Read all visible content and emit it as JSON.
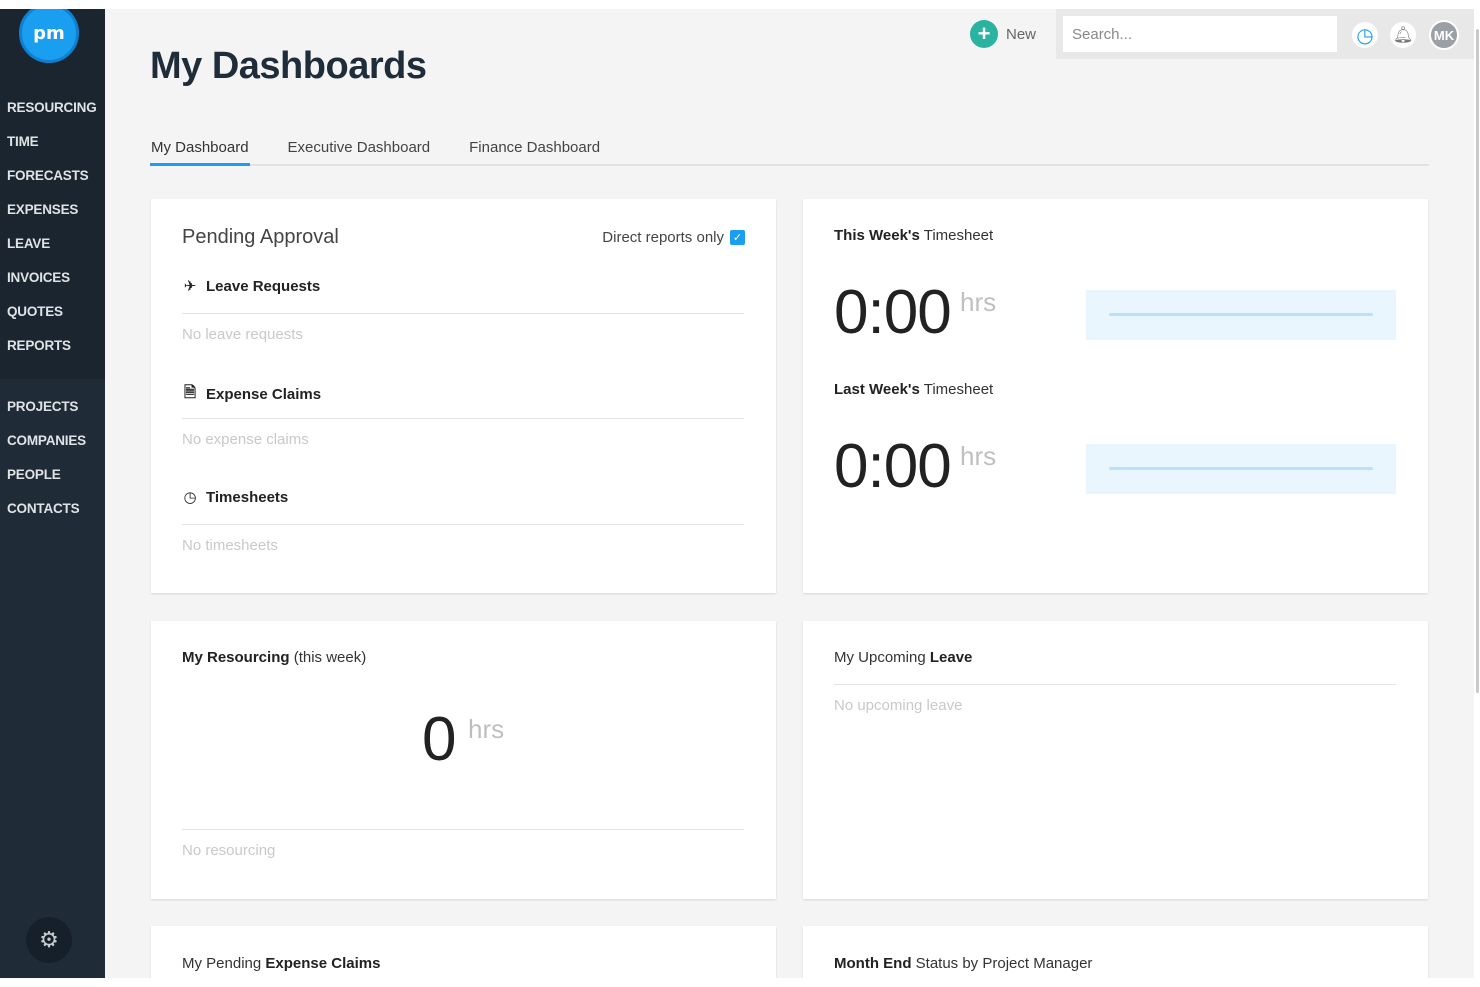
{
  "sidebar": {
    "logo_text": "pm",
    "groups": [
      {
        "items": [
          "RESOURCING",
          "TIME",
          "FORECASTS",
          "EXPENSES",
          "LEAVE",
          "INVOICES",
          "QUOTES",
          "REPORTS"
        ]
      },
      {
        "items": [
          "PROJECTS",
          "COMPANIES",
          "PEOPLE",
          "CONTACTS"
        ]
      }
    ],
    "settings_icon": "gear-icon"
  },
  "header": {
    "title": "My Dashboards",
    "new_label": "New",
    "search_placeholder": "Search...",
    "avatar_initials": "MK",
    "accent": "#1a9ff0",
    "new_color": "#2bb3a1"
  },
  "tabs": [
    {
      "label": "My Dashboard",
      "active": true
    },
    {
      "label": "Executive Dashboard",
      "active": false
    },
    {
      "label": "Finance Dashboard",
      "active": false
    }
  ],
  "pending": {
    "title": "Pending Approval",
    "direct_label": "Direct reports only",
    "direct_checked": true,
    "sections": [
      {
        "label": "Leave Requests",
        "icon": "plane-icon",
        "empty": "No leave requests"
      },
      {
        "label": "Expense Claims",
        "icon": "receipt-icon",
        "empty": "No expense claims"
      },
      {
        "label": "Timesheets",
        "icon": "clock-icon",
        "empty": "No timesheets"
      }
    ]
  },
  "timesheet": {
    "this_week_bold": "This Week's",
    "this_week_rest": " Timesheet",
    "this_week_value": "0:00",
    "last_week_bold": "Last Week's",
    "last_week_rest": " Timesheet",
    "last_week_value": "0:00",
    "unit": "hrs"
  },
  "resourcing": {
    "title_bold": "My Resourcing",
    "title_rest": " (this week)",
    "value": "0",
    "unit": "hrs",
    "empty": "No resourcing"
  },
  "leave": {
    "title_plain": "My Upcoming ",
    "title_bold": "Leave",
    "empty": "No upcoming leave"
  },
  "expense_claims": {
    "title_plain": "My Pending ",
    "title_bold": "Expense Claims"
  },
  "month_end": {
    "title_bold": "Month End",
    "title_rest": " Status by Project Manager"
  }
}
